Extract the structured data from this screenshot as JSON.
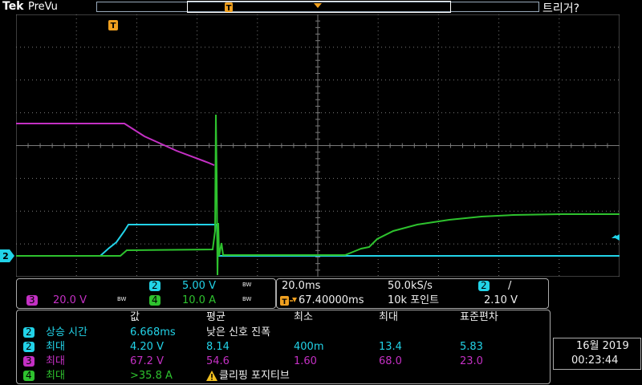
{
  "header": {
    "logo": "Tek",
    "acq_state": "PreVu",
    "trigger_status": "트리거?"
  },
  "markers": {
    "trigger_marker": "T",
    "ch2_ground": "2"
  },
  "colors": {
    "ch2": "#22d3e8",
    "ch3": "#c430c4",
    "ch4": "#2ec22e",
    "trigger_orange": "#f0a020",
    "grid": "#7a7a7a"
  },
  "channels": {
    "ch2": {
      "id": "2",
      "scale": "5.00 V",
      "bw": "BW"
    },
    "ch3": {
      "id": "3",
      "scale": "20.0 V",
      "bw": "BW"
    },
    "ch4": {
      "id": "4",
      "scale": "10.0 A",
      "bw": "BW"
    }
  },
  "timebase": {
    "scale": "20.0ms",
    "sample_rate": "50.0kS/s",
    "position": "67.40000ms",
    "record_length": "10k 포인트",
    "trigger_channel": "2",
    "trigger_slope": "/",
    "trigger_level": "2.10 V"
  },
  "measurements": {
    "headers": [
      "값",
      "평균",
      "최소",
      "최대",
      "표준편차"
    ],
    "rows": [
      {
        "ch": "2",
        "name": "상승 시간",
        "value": "6.668ms",
        "mean": "낮은 신호 진폭",
        "min": "",
        "max": "",
        "std": "",
        "color": "#22d3e8"
      },
      {
        "ch": "2",
        "name": "최대",
        "value": "4.20 V",
        "mean": "8.14",
        "min": "400m",
        "max": "13.4",
        "std": "5.83",
        "color": "#22d3e8"
      },
      {
        "ch": "3",
        "name": "최대",
        "value": "67.2 V",
        "mean": "54.6",
        "min": "1.60",
        "max": "68.0",
        "std": "23.0",
        "color": "#c430c4"
      },
      {
        "ch": "4",
        "name": "최대",
        "value": ">35.8 A",
        "mean": "클리핑 포지티브",
        "min": "",
        "max": "",
        "std": "",
        "color": "#2ec22e"
      }
    ],
    "warning_icon": "warning-triangle-icon"
  },
  "datetime": {
    "date": "16월 2019",
    "time": "00:23:44"
  }
}
